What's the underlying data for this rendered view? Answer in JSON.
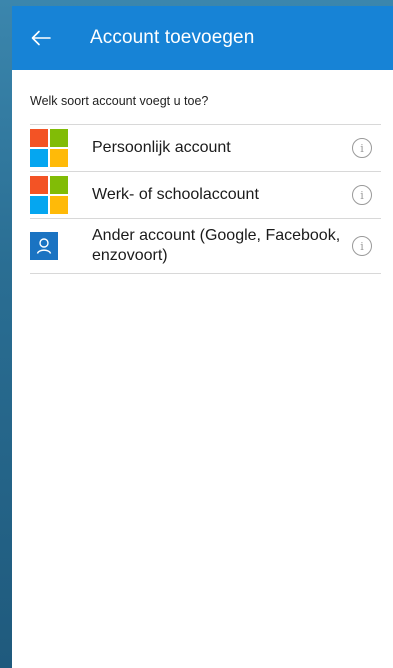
{
  "appbar": {
    "title": "Account toevoegen",
    "back_icon": "arrow-left-icon"
  },
  "prompt": "Welk soort account voegt u toe?",
  "accounts": [
    {
      "label": "Persoonlijk account",
      "icon": "microsoft-logo-icon",
      "info_icon": "info-icon"
    },
    {
      "label": "Werk- of schoolaccount",
      "icon": "microsoft-logo-icon",
      "info_icon": "info-icon"
    },
    {
      "label": "Ander account (Google, Facebook, enzovoort)",
      "icon": "person-icon",
      "info_icon": "info-icon"
    }
  ],
  "info_glyph": "i",
  "colors": {
    "appbar": "#1783d6",
    "ms_red": "#f35325",
    "ms_green": "#81bc06",
    "ms_blue": "#05a6f0",
    "ms_yellow": "#ffba08",
    "person_bg": "#1a73c2"
  }
}
